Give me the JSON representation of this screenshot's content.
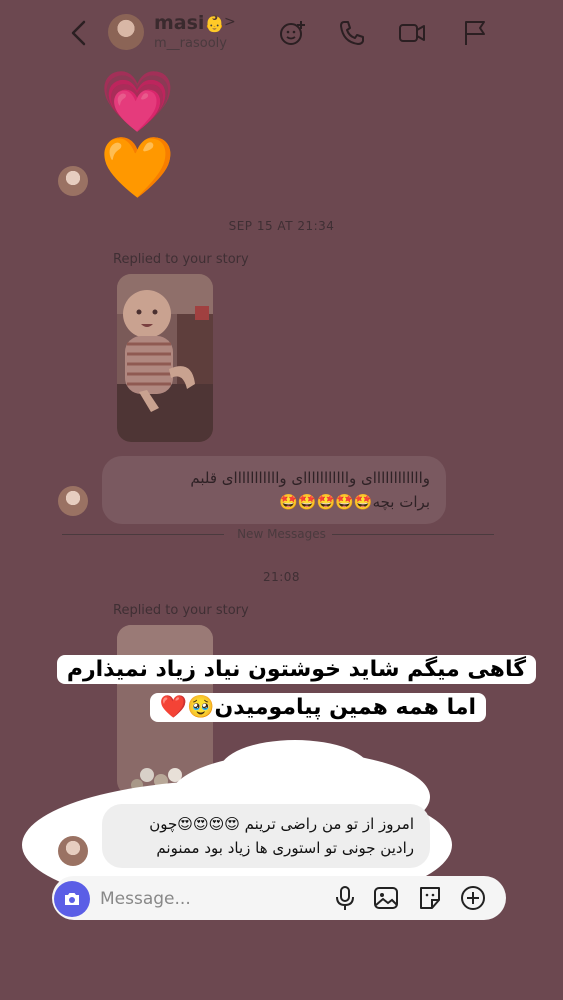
{
  "header": {
    "name": "masi",
    "name_emoji": "👶",
    "username": "m__rasooly",
    "chevron": ">"
  },
  "conversation": {
    "hearts": [
      "💗",
      "🧡"
    ],
    "timestamp_1": "SEP 15 AT 21:34",
    "reply_label_1": "Replied to your story",
    "message_1_line1": "واااااااااااای وااااااااااای وااااااااااای قلبم",
    "message_1_line2": "برات بچه🤩🤩🤩🤩🤩",
    "new_messages": "New Messages",
    "timestamp_2": "21:08",
    "reply_label_2": "Replied to your story",
    "overlay_line1": "گاهی میگم شاید خوشتون نیاد زیاد نمیذارم",
    "overlay_line2": "اما همه همین پیامومیدن🥹❤️",
    "message_2_line1": "امروز از تو من راضی ترینم 😍😍😍😍چون",
    "message_2_line2": "رادین جونی تو استوری ها زیاد بود ممنونم"
  },
  "composer": {
    "placeholder": "Message..."
  },
  "icons": {
    "back": "chevron-left-icon",
    "effects": "smiley-plus-icon",
    "call": "phone-icon",
    "video": "video-camera-icon",
    "report": "flag-icon",
    "camera": "camera-icon",
    "mic": "microphone-icon",
    "gallery": "image-icon",
    "sticker": "sticker-icon",
    "plus": "plus-circle-icon"
  },
  "colors": {
    "background": "#6c4850",
    "camera_button": "#5b5ee6",
    "overlay_bg": "#ffffff"
  }
}
